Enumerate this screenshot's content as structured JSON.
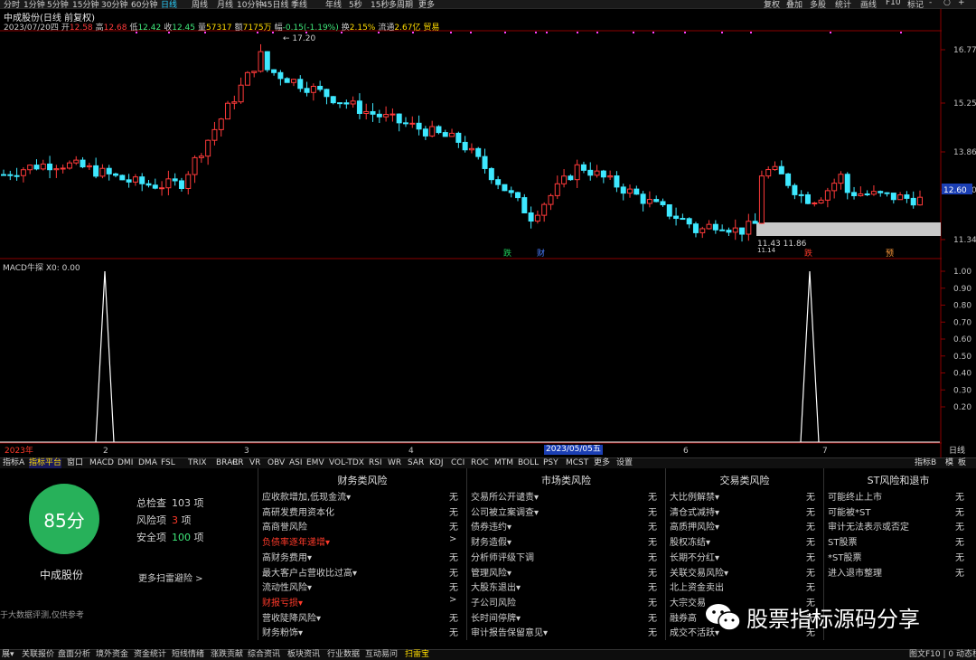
{
  "toolbar": {
    "periods": [
      "分时",
      "1分钟",
      "5分钟",
      "15分钟",
      "30分钟",
      "60分钟",
      "日线",
      "周线",
      "月线",
      "10分钟",
      "45日线",
      "季线",
      "年线",
      "5秒",
      "15秒",
      "多周期",
      "更多"
    ],
    "active_period": "日线",
    "right": [
      "复权",
      "叠加",
      "多股",
      "统计",
      "画线",
      "F10",
      "标记",
      "-",
      "○",
      "+"
    ]
  },
  "header": {
    "title": "中成股份(日线 前复权)",
    "date": "2023/07/20四",
    "open_label": "开",
    "open": "12.58",
    "high_label": "高",
    "high": "12.68",
    "low_label": "低",
    "low": "12.42",
    "close_label": "收",
    "close": "12.45",
    "vol_label": "量",
    "vol": "57317",
    "amount_label": "额",
    "amount": "7175万",
    "chg_label": "幅",
    "chg": "-0.15(-1.19%)",
    "turnover_label": "换",
    "turnover": "2.15%",
    "float_label": "流通",
    "float": "2.67亿",
    "sector": "贸易"
  },
  "price_axis": {
    "ticks": [
      "16.77",
      "15.25",
      "13.86",
      "12.60",
      "11.34"
    ],
    "current": "12.60"
  },
  "price_annotations": {
    "high": "17.20",
    "low": "11.43",
    "low2": "11.86",
    "low_prefix": "11.14"
  },
  "event_markers": [
    {
      "label": "跌",
      "color": "#1fd05a"
    },
    {
      "label": "财",
      "color": "#4a7dff"
    },
    {
      "label": "跌",
      "color": "#ff3a2a"
    },
    {
      "label": "预",
      "color": "#ff9a3a"
    }
  ],
  "indicator": {
    "title": "MACD牛探  X0: 0.00",
    "axis": [
      "1.00",
      "0.90",
      "0.80",
      "0.70",
      "0.60",
      "0.50",
      "0.40",
      "0.30",
      "0.20"
    ],
    "signal_days": [
      1,
      0
    ]
  },
  "time_axis": {
    "labels": [
      "2023年",
      "2",
      "3",
      "4",
      "2023/05/05五",
      "6",
      "7"
    ],
    "right": "日线"
  },
  "tabs": {
    "items": [
      "指标A",
      "指标平台",
      "窗口",
      "MACD",
      "DMI",
      "DMA",
      "FSL",
      "TRIX",
      "BRAR",
      "CR",
      "VR",
      "OBV",
      "ASI",
      "EMV",
      "VOL-TDX",
      "RSI",
      "WR",
      "SAR",
      "KDJ",
      "CCI",
      "ROC",
      "MTM",
      "BOLL",
      "PSY",
      "MCST",
      "更多",
      "设置"
    ],
    "selected": "指标平台",
    "right": [
      "指标B",
      "模",
      "板"
    ]
  },
  "risk_panel": {
    "score": "85分",
    "company": "中成股份",
    "total_label": "总检查",
    "total": "103",
    "unit": "项",
    "risk_label": "风险项",
    "risk": "3",
    "safe_label": "安全项",
    "safe": "100",
    "more": "更多扫雷避险 >",
    "note": "于大数据评测,仅供参考",
    "columns": [
      {
        "title": "财务类风险",
        "rows": [
          {
            "label": "应收款增加,低现金流▾",
            "result": "无"
          },
          {
            "label": "高研发费用资本化",
            "result": "无"
          },
          {
            "label": "高商誉风险",
            "result": "无"
          },
          {
            "label": "负债率逐年递增▾",
            "result": ">",
            "flag": true
          },
          {
            "label": "高财务费用▾",
            "result": "无"
          },
          {
            "label": "最大客户占营收比过高▾",
            "result": "无"
          },
          {
            "label": "流动性风险▾",
            "result": "无"
          },
          {
            "label": "财报亏损▾",
            "result": ">",
            "flag": true
          },
          {
            "label": "营收陡降风险▾",
            "result": "无"
          },
          {
            "label": "财务粉饰▾",
            "result": "无"
          }
        ]
      },
      {
        "title": "市场类风险",
        "rows": [
          {
            "label": "交易所公开谴责▾",
            "result": "无"
          },
          {
            "label": "公司被立案调查▾",
            "result": "无"
          },
          {
            "label": "债券违约▾",
            "result": "无"
          },
          {
            "label": "财务造假▾",
            "result": "无"
          },
          {
            "label": "分析师评级下调",
            "result": "无"
          },
          {
            "label": "管理风险▾",
            "result": "无"
          },
          {
            "label": "大股东退出▾",
            "result": "无"
          },
          {
            "label": "子公司风险",
            "result": "无"
          },
          {
            "label": "长时间停牌▾",
            "result": "无"
          },
          {
            "label": "审计报告保留意见▾",
            "result": "无"
          }
        ]
      },
      {
        "title": "交易类风险",
        "rows": [
          {
            "label": "大比例解禁▾",
            "result": "无"
          },
          {
            "label": "清仓式减持▾",
            "result": "无"
          },
          {
            "label": "高质押风险▾",
            "result": "无"
          },
          {
            "label": "股权冻结▾",
            "result": "无"
          },
          {
            "label": "长期不分红▾",
            "result": "无"
          },
          {
            "label": "关联交易风险▾",
            "result": "无"
          },
          {
            "label": "北上资金卖出",
            "result": "无"
          },
          {
            "label": "大宗交易",
            "result": "无"
          },
          {
            "label": "融券高",
            "result": "无"
          },
          {
            "label": "成交不活跃▾",
            "result": "无"
          }
        ]
      },
      {
        "title": "ST风险和退市",
        "rows": [
          {
            "label": "可能终止上市",
            "result": "无"
          },
          {
            "label": "可能被*ST",
            "result": "无"
          },
          {
            "label": "审计无法表示或否定",
            "result": "无"
          },
          {
            "label": "ST股票",
            "result": "无"
          },
          {
            "label": "*ST股票",
            "result": "无"
          },
          {
            "label": "进入退市整理",
            "result": "无"
          }
        ]
      }
    ],
    "watermark": "股票指标源码分享"
  },
  "bottom_bar": {
    "items": [
      "展▾",
      "关联报价",
      "盘面分析",
      "境外资金",
      "资金统计",
      "短线情绪",
      "涨跌贡献",
      "综合资讯",
      "板块资讯",
      "行业数据",
      "互动易问",
      "扫雷宝"
    ],
    "selected": "扫雷宝",
    "right": "图文F10 | 0 动态栏>>"
  },
  "colors": {
    "up": "#ff3a3a",
    "down": "#3ee8ff",
    "accent": "#ffdc00",
    "score": "#27b15a"
  }
}
